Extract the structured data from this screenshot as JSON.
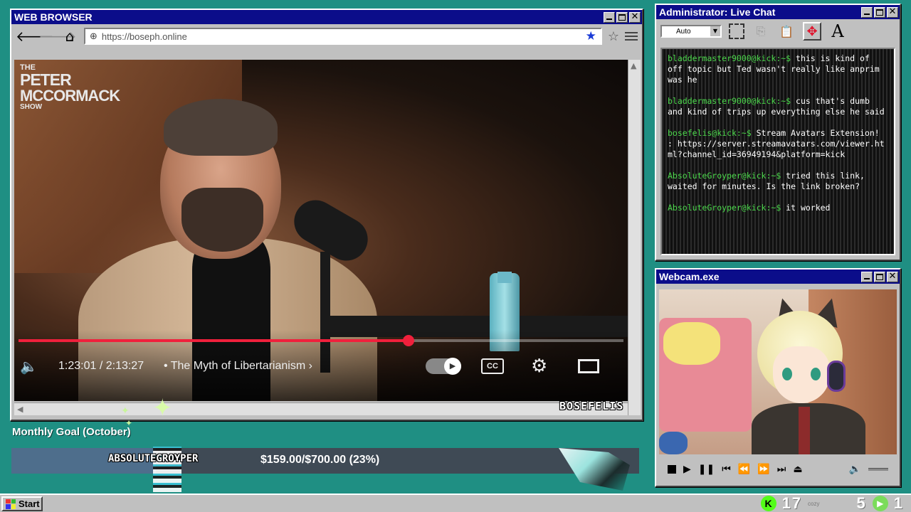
{
  "browser": {
    "title": "WEB BROWSER",
    "url": "https://boseph.online",
    "nav": {
      "back": "🡐",
      "forward": "🡒",
      "home": "⌂"
    },
    "icons": {
      "bookmark_filled": "star-filled-icon",
      "bookmark": "star-outline-icon",
      "menu": "hamburger-menu-icon",
      "site": "globe-icon"
    },
    "video": {
      "show_logo": {
        "line1": "THE",
        "line2": "PETER",
        "line3": "MCCORMACK",
        "line4": "SHOW"
      },
      "time": "1:23:01 / 2:13:27",
      "chapter": "• The Myth of Libertarianism ›",
      "progress": 0.645,
      "cc_label": "CC",
      "accent": "#f0203c"
    },
    "watermark": "BOSEFELIS"
  },
  "chat": {
    "title": "Administrator: Live Chat",
    "auto_label": "Auto",
    "font_tool": "A",
    "messages": [
      {
        "user": "bladdermaster9000@kick:~$",
        "text": " this is kind of off topic but Ted wasn't really like anprim was he"
      },
      {
        "user": "bladdermaster9000@kick:~$",
        "text": " cus that's dumb and kind of trips up everything else he said"
      },
      {
        "user": "bosefelis@kick:~$",
        "text": " Stream Avatars Extension! : https://server.streamavatars.com/viewer.html?channel_id=36949194&platform=kick"
      },
      {
        "user": "AbsoluteGroyper@kick:~$",
        "text": " tried this link, waited for minutes. Is the link broken?"
      },
      {
        "user": "AbsoluteGroyper@kick:~$",
        "text": " it worked"
      }
    ],
    "user_color": "#4bd84b"
  },
  "webcam": {
    "title": "Webcam.exe"
  },
  "goal": {
    "label": "Monthly Goal (October)",
    "amount": "$159.00/$700.00 (23%)",
    "fraction": 0.23,
    "top_user": "ABSOLUTEGROYPER"
  },
  "taskbar": {
    "start_label": "Start",
    "kick_letter": "K",
    "count_a": "17",
    "count_a_label": "cozy",
    "count_b": "5",
    "count_c": "1"
  }
}
